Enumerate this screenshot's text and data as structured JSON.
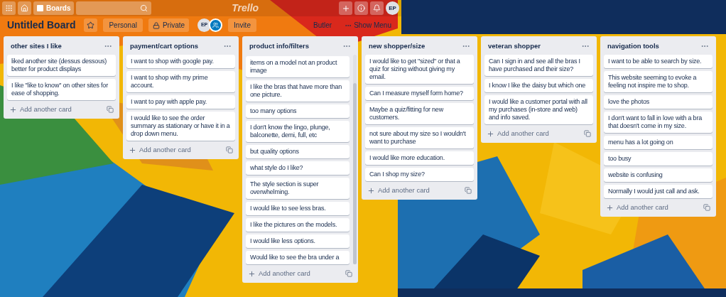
{
  "header": {
    "boards": "Boards",
    "logo": "Trello",
    "avatar": "EP"
  },
  "board_bar": {
    "title": "Untitled Board",
    "starred": false,
    "team": "Personal",
    "privacy": "Private",
    "members": [
      "EP"
    ],
    "invite": "Invite",
    "butler": "Butler",
    "menu": "Show Menu"
  },
  "lists": [
    {
      "title": "other sites I like",
      "scrolled": false,
      "cards": [
        "liked another site (dessus dessous) better for product displays",
        "I like \"like to know\" on other sites for ease of shopping."
      ],
      "add": "Add another card"
    },
    {
      "title": "payment/cart options",
      "scrolled": false,
      "cards": [
        "I want to shop with google pay.",
        "I want to shop with my prime account.",
        "I want to pay with apple pay.",
        "I would like to see the order summary as stationary or have it in a drop down menu."
      ],
      "add": "Add another card"
    },
    {
      "title": "product info/filters",
      "scrolled": true,
      "cards": [
        "items on a model not an product image",
        "I like the bras that have more than one picture.",
        "too many options",
        "I don't know the lingo, plunge, balconette, demi, full, etc",
        "but quality options",
        "what style do I like?",
        "The style section is super overwhelming.",
        "I would like to see less bras.",
        "I like the pictures on the models.",
        "I would like less options.",
        "Would like to see the bra under a"
      ],
      "add": "Add another card"
    },
    {
      "title": "new shopper/size",
      "scrolled": false,
      "cards": [
        "I would like to get \"sized\" or that a quiz for sizing without giving my email.",
        "Can I measure myself form home?",
        "Maybe a quiz/fitting for new customers.",
        "not sure about my size so I wouldn't want to purchase",
        "I would like more education.",
        "Can I shop my size?"
      ],
      "add": "Add another card"
    },
    {
      "title": "veteran shopper",
      "scrolled": false,
      "cards": [
        "Can I sign in and see all the bras I have purchased and their size?",
        "I know I like the daisy but which one",
        "I would like a customer portal with all my purchases (in-store and web) and info saved."
      ],
      "add": "Add another card"
    },
    {
      "title": "navigation tools",
      "scrolled": false,
      "cards": [
        "I want to be able to search by size.",
        "This website seeming to evoke a feeling not inspire me to shop.",
        "love the photos",
        "I don't want to fall in love with a bra that doesn't come in my size.",
        "menu has a lot going on",
        "too busy",
        "website is confusing",
        "Normally I would just call and ask."
      ],
      "add": "Add another card"
    }
  ]
}
